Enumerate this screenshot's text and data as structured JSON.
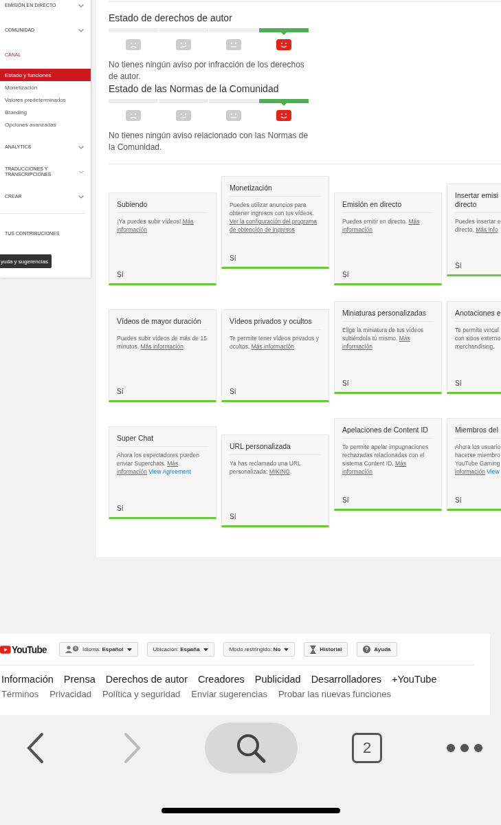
{
  "sidebar": {
    "items": [
      {
        "kind": "section",
        "label": "EMISIÓN EN DIRECTO",
        "selected": false,
        "expanded": false
      },
      {
        "kind": "section",
        "label": "COMUNIDAD",
        "selected": false,
        "expanded": false
      },
      {
        "kind": "section",
        "label": "CANAL",
        "selected": true,
        "expanded": true,
        "children": [
          {
            "label": "Estado y funciones",
            "selected": true
          },
          {
            "label": "Monetización",
            "selected": false
          },
          {
            "label": "Valores predeterminados",
            "selected": false
          },
          {
            "label": "Branding",
            "selected": false
          },
          {
            "label": "Opciones avanzadas",
            "selected": false
          }
        ]
      },
      {
        "kind": "section",
        "label": "ANALYTICS",
        "selected": false,
        "expanded": false
      },
      {
        "kind": "section",
        "label": "TRADUCCIONES Y TRANSCRIPCIONES",
        "selected": false,
        "expanded": false
      },
      {
        "kind": "section",
        "label": "CREAR",
        "selected": false,
        "expanded": false
      },
      {
        "kind": "link",
        "label": "TUS CONTRIBUCIONES",
        "selected": false
      }
    ],
    "help_button": "yuda y sugerencias"
  },
  "status_sections": [
    {
      "title": "Estado de derechos de autor",
      "segments": [
        {
          "selected": false
        },
        {
          "selected": false
        },
        {
          "selected": false
        },
        {
          "selected": true
        }
      ],
      "message": "No tienes ningún aviso por infracción de los derechos de autor."
    },
    {
      "title": "Estado de las Normas de la Comunidad",
      "segments": [
        {
          "selected": false
        },
        {
          "selected": false
        },
        {
          "selected": false
        },
        {
          "selected": true
        }
      ],
      "message": "No tienes ningún aviso relacionado con las Normas de la Comunidad."
    }
  ],
  "feature_rows": [
    {
      "cards": [
        {
          "title": "Subiendo",
          "description": [
            {
              "kind": "plain",
              "text": "¡Ya puedes subir vídeos! "
            },
            {
              "kind": "link",
              "text": "Más"
            },
            {
              "kind": "link",
              "text": "información"
            }
          ],
          "status": "Sí"
        },
        {
          "title": "Monetización",
          "description": [
            {
              "kind": "plain",
              "text": "Puedes utilizar anuncios para obtener ingresos con tus vídeos. "
            },
            {
              "kind": "link",
              "text": "Ver la configuración del programa"
            },
            {
              "kind": "link",
              "text": "de obtención de ingresos"
            }
          ],
          "status": "Sí"
        },
        {
          "title": "Emisión en directo",
          "description": [
            {
              "kind": "plain",
              "text": "Puedes emitir en directo. "
            },
            {
              "kind": "link",
              "text": "Más"
            },
            {
              "kind": "link",
              "text": "información"
            }
          ],
          "status": "Sí"
        },
        {
          "title": "Insertar emisi\ndirecto",
          "description": [
            {
              "kind": "plain",
              "text": "Puedes insertar e\ndirecto. "
            },
            {
              "kind": "link",
              "text": "Más info"
            }
          ],
          "status": "Sí"
        }
      ]
    },
    {
      "cards": [
        {
          "title": "Vídeos de mayor duración",
          "description": [
            {
              "kind": "plain",
              "text": "Puedes subir vídeos de más de 15 minutos. "
            },
            {
              "kind": "link",
              "text": "Más información"
            }
          ],
          "status": "Sí"
        },
        {
          "title": "Vídeos privados y ocultos",
          "description": [
            {
              "kind": "plain",
              "text": "Te permite tener vídeos privados y ocultos. "
            },
            {
              "kind": "link",
              "text": "Más información"
            }
          ],
          "status": "Sí"
        },
        {
          "title": "Miniaturas personalizadas",
          "description": [
            {
              "kind": "plain",
              "text": "Elige la miniatura de tus vídeos subiéndola tú mismo. "
            },
            {
              "kind": "link",
              "text": "Más"
            },
            {
              "kind": "link",
              "text": "información"
            }
          ],
          "status": "Sí"
        },
        {
          "title": "Anotaciones e",
          "description": [
            {
              "kind": "plain",
              "text": "Te permite vincul\ncon sitios externo\nmerchandising."
            }
          ],
          "status": "Sí"
        }
      ]
    },
    {
      "cards": [
        {
          "title": "Super Chat",
          "description": [
            {
              "kind": "plain",
              "text": "Ahora los espectadores pueden enviar Superchats. "
            },
            {
              "kind": "link",
              "text": "Más"
            },
            {
              "kind": "link",
              "text": "información"
            },
            {
              "kind": "agreement",
              "text": "View Agreement"
            }
          ],
          "status": "Sí"
        },
        {
          "title": "URL personalizada",
          "description": [
            {
              "kind": "plain",
              "text": "Ya has reclamado una URL personalizada: "
            },
            {
              "kind": "link",
              "text": "MIKING"
            },
            {
              "kind": "plain",
              "text": "."
            }
          ],
          "status": "Sí"
        },
        {
          "title": "Apelaciones de Content ID",
          "description": [
            {
              "kind": "plain",
              "text": "Te permite apelar impugnaciones rechazadas relacionadas con el sistema Content ID. "
            },
            {
              "kind": "link",
              "text": "Más"
            },
            {
              "kind": "link",
              "text": "información"
            }
          ],
          "status": "Sí"
        },
        {
          "title": "Miembros del",
          "description": [
            {
              "kind": "plain",
              "text": "Ahora los usuario\nhacerse miembro\nYouTube Gaming\n"
            },
            {
              "kind": "link",
              "text": "información"
            },
            {
              "kind": "agreement",
              "text": "View"
            }
          ],
          "status": "Sí"
        }
      ]
    }
  ],
  "footer": {
    "logo": "YouTube",
    "buttons": [
      {
        "kind": "language",
        "label": "Idioma: **Español**",
        "dropdown": true
      },
      {
        "kind": "plain",
        "label": "Ubicación: **España**",
        "dropdown": true
      },
      {
        "kind": "plain",
        "label": "Modo restringido: **No**",
        "dropdown": true
      },
      {
        "kind": "history",
        "label": "Historial",
        "dropdown": false
      },
      {
        "kind": "help",
        "label": "Ayuda",
        "dropdown": false
      }
    ],
    "primary_links": [
      "Información",
      "Prensa",
      "Derechos de autor",
      "Creadores",
      "Publicidad",
      "Desarrolladores",
      "+YouTube"
    ],
    "secondary_links": [
      "Términos",
      "Privacidad",
      "Política y seguridad",
      "Enviar sugerencias",
      "Probar las nuevas funciones"
    ]
  },
  "browser_bar": {
    "back_enabled": true,
    "forward_enabled": false,
    "tab_count": "2"
  }
}
